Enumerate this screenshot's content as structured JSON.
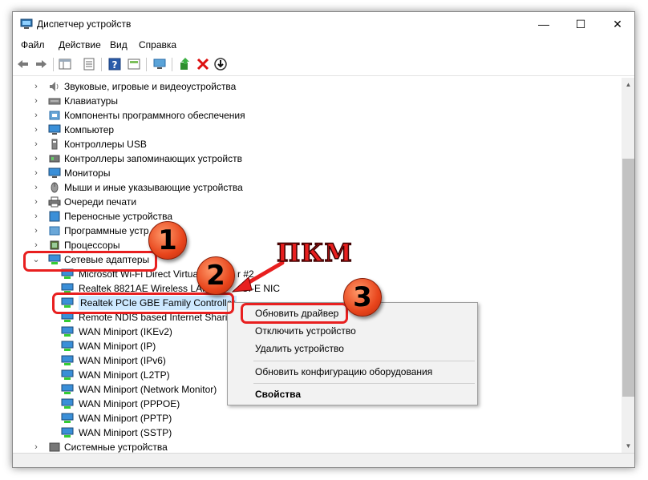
{
  "window": {
    "title": "Диспетчер устройств"
  },
  "window_buttons": {
    "minimize": "—",
    "maximize": "☐",
    "close": "✕"
  },
  "menu": [
    "Файл",
    "Действие",
    "Вид",
    "Справка"
  ],
  "tree": {
    "categories": [
      {
        "label": "Звуковые, игровые и видеоустройства",
        "icon": "speaker-icon"
      },
      {
        "label": "Клавиатуры",
        "icon": "keyboard-icon"
      },
      {
        "label": "Компоненты программного обеспечения",
        "icon": "software-component-icon"
      },
      {
        "label": "Компьютер",
        "icon": "computer-icon"
      },
      {
        "label": "Контроллеры USB",
        "icon": "usb-icon"
      },
      {
        "label": "Контроллеры запоминающих устройств",
        "icon": "storage-controller-icon"
      },
      {
        "label": "Мониторы",
        "icon": "monitor-icon"
      },
      {
        "label": "Мыши и иные указывающие устройства",
        "icon": "mouse-icon"
      },
      {
        "label": "Очереди печати",
        "icon": "printer-icon"
      },
      {
        "label": "Переносные устройства",
        "icon": "portable-device-icon"
      },
      {
        "label": "Программные устр",
        "icon": "software-device-icon"
      },
      {
        "label": "Процессоры",
        "icon": "processor-icon"
      }
    ],
    "expanded_category": "Сетевые адаптеры",
    "adapters": [
      "Microsoft Wi-Fi Direct Virtua",
      "Realtek 8821AE Wireless LAN",
      "Realtek PCIe GBE Family Controller",
      "Remote NDIS based Internet Sharin",
      "WAN Miniport (IKEv2)",
      "WAN Miniport (IP)",
      "WAN Miniport (IPv6)",
      "WAN Miniport (L2TP)",
      "WAN Miniport (Network Monitor)",
      "WAN Miniport (PPPOE)",
      "WAN Miniport (PPTP)",
      "WAN Miniport (SSTP)"
    ],
    "adapter_fragments": {
      "wifi_direct_tail": "r #2",
      "realtek_8821_tail": "CI-E NIC"
    },
    "last_category": "Системные устройства"
  },
  "context_menu": {
    "update_driver": "Обновить драйвер",
    "disable": "Отключить устройство",
    "uninstall": "Удалить устройство",
    "scan": "Обновить конфигурацию оборудования",
    "properties": "Свойства"
  },
  "annotations": {
    "badge1": "1",
    "badge2": "2",
    "badge3": "3",
    "pkm_label": "ПКМ"
  },
  "colors": {
    "highlight": "#e81f1f",
    "badge": "#e8451c",
    "selection": "#cce8ff"
  }
}
